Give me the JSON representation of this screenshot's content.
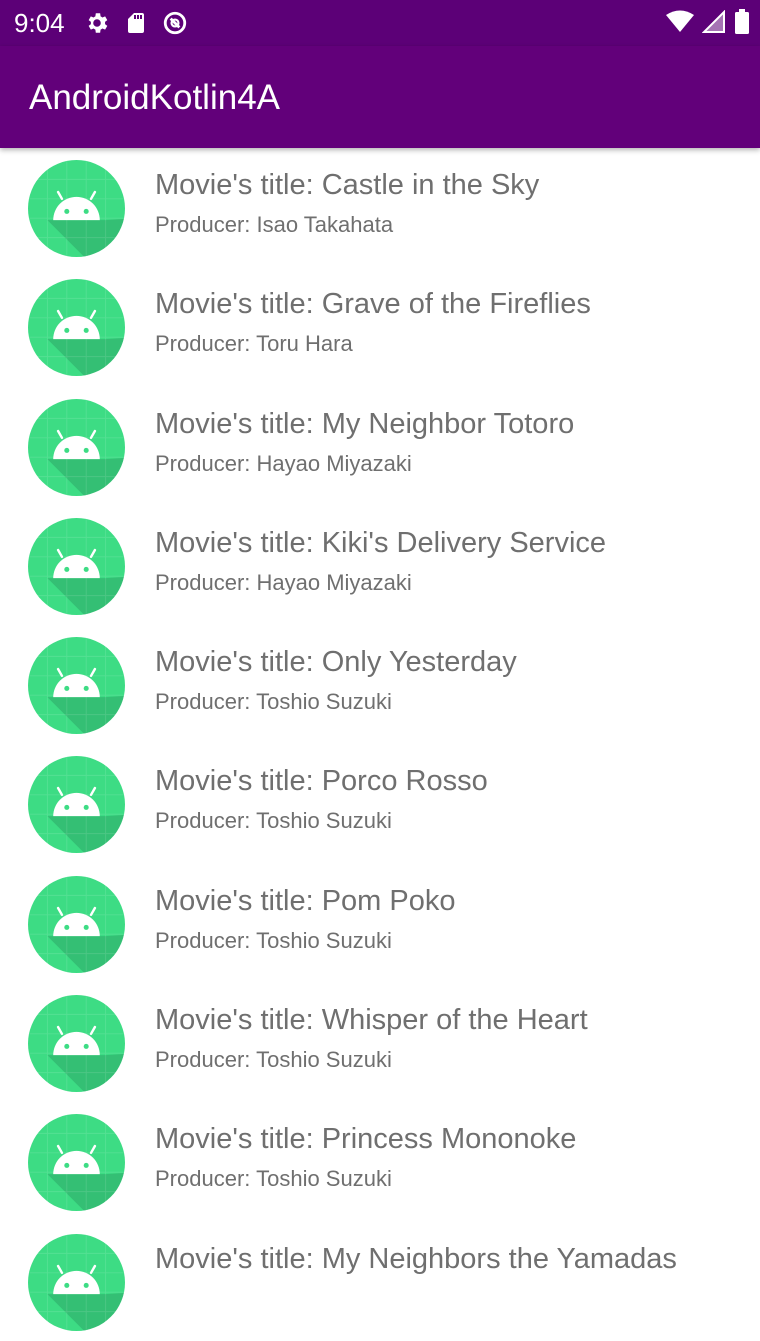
{
  "status_bar": {
    "time": "9:04",
    "left_icons": [
      "settings-icon",
      "sd-card-icon",
      "data-saver-icon"
    ],
    "right_icons": [
      "wifi-icon",
      "cellular-signal-icon",
      "battery-icon"
    ]
  },
  "app_bar": {
    "title": "AndroidKotlin4A",
    "color": "#62007a"
  },
  "movies": [
    {
      "title": "Movie's title: Castle in the Sky",
      "producer": "Producer: Isao Takahata"
    },
    {
      "title": "Movie's title: Grave of the Fireflies",
      "producer": "Producer: Toru Hara"
    },
    {
      "title": "Movie's title: My Neighbor Totoro",
      "producer": "Producer: Hayao Miyazaki"
    },
    {
      "title": "Movie's title: Kiki's Delivery Service",
      "producer": "Producer: Hayao Miyazaki"
    },
    {
      "title": "Movie's title: Only Yesterday",
      "producer": "Producer: Toshio Suzuki"
    },
    {
      "title": "Movie's title: Porco Rosso",
      "producer": "Producer: Toshio Suzuki"
    },
    {
      "title": "Movie's title: Pom Poko",
      "producer": "Producer: Toshio Suzuki"
    },
    {
      "title": "Movie's title: Whisper of the Heart",
      "producer": "Producer: Toshio Suzuki"
    },
    {
      "title": "Movie's title: Princess Mononoke",
      "producer": "Producer: Toshio Suzuki"
    },
    {
      "title": "Movie's title: My Neighbors the Yamadas",
      "producer": ""
    }
  ],
  "avatar_icon": "android-robot-icon",
  "colors": {
    "avatar_green": "#3ddc84",
    "text_grey": "#6f6f6f"
  }
}
